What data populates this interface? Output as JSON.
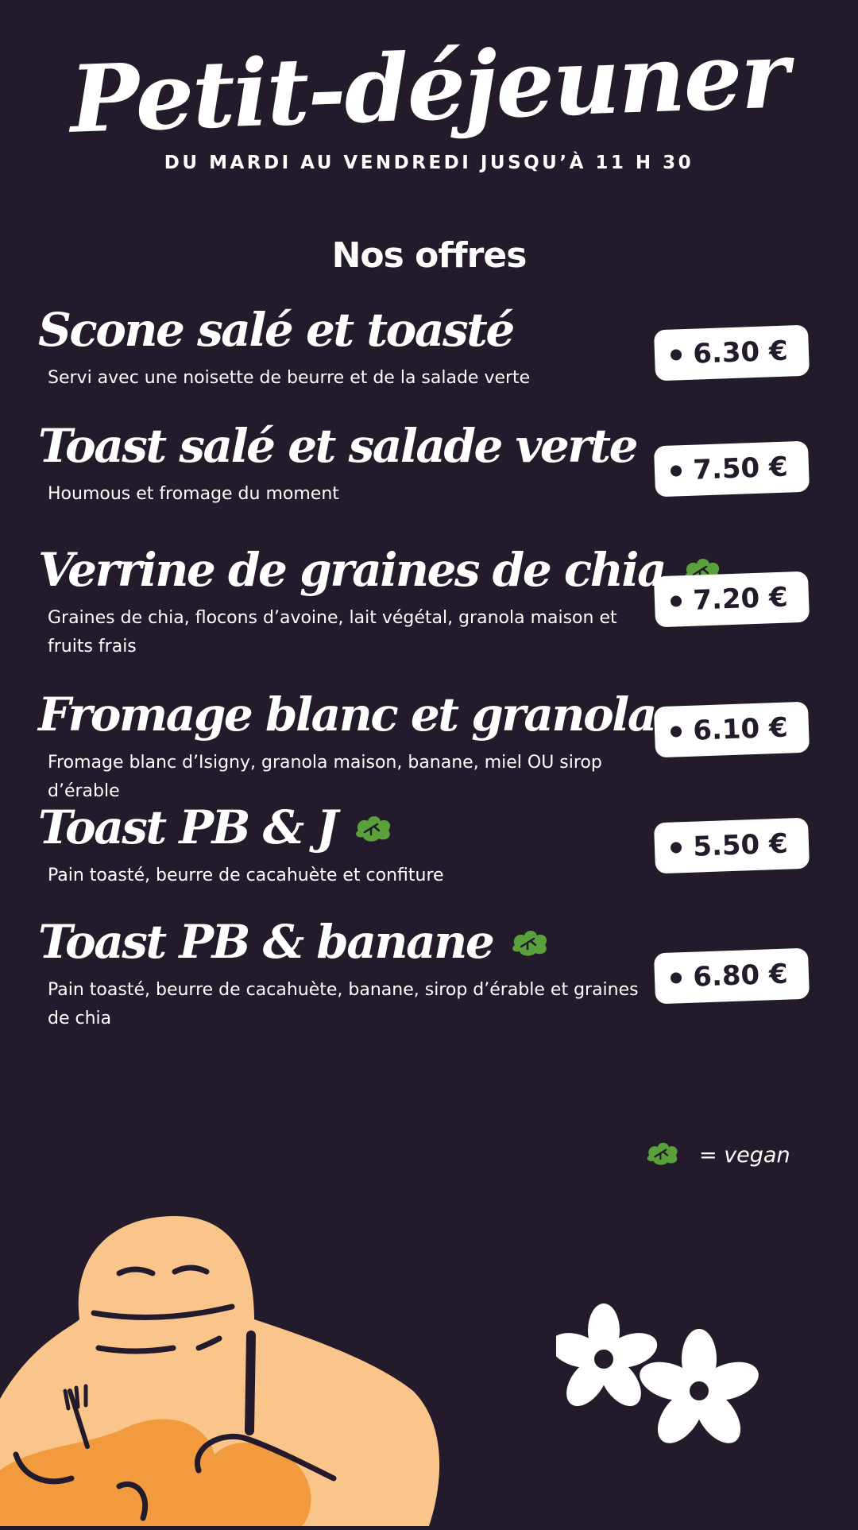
{
  "header": {
    "title": "Petit-déjeuner",
    "subtitle": "DU MARDI AU VENDREDI JUSQU’À 11 H 30"
  },
  "section_title": "Nos offres",
  "items": [
    {
      "name": "Scone salé et toasté",
      "description": "Servi avec une noisette de beurre et de la salade verte",
      "price": "6.30 €",
      "vegan": false
    },
    {
      "name": "Toast salé et salade verte",
      "description": "Houmous et fromage du moment",
      "price": "7.50 €",
      "vegan": false
    },
    {
      "name": "Verrine de graines de chia",
      "description": "Graines de chia, flocons d’avoine, lait végétal, granola maison et fruits frais",
      "price": "7.20 €",
      "vegan": true
    },
    {
      "name": "Fromage blanc et granola",
      "description": "Fromage blanc d’Isigny, granola maison, banane, miel OU sirop d’érable",
      "price": "6.10 €",
      "vegan": false
    },
    {
      "name": "Toast PB & J",
      "description": "Pain toasté, beurre de cacahuète et confiture",
      "price": "5.50 €",
      "vegan": true
    },
    {
      "name": "Toast PB & banane",
      "description": "Pain toasté, beurre de cacahuète, banane, sirop d’érable et graines de chia",
      "price": "6.80 €",
      "vegan": true
    }
  ],
  "legend": {
    "text": "= vegan",
    "icon": "vegan-leaf-icon"
  },
  "colors": {
    "background": "#231b2b",
    "text": "#ffffff",
    "vegan_green": "#5aa13c",
    "mascot_light": "#f9c58b",
    "mascot_dark": "#f19a3e"
  }
}
